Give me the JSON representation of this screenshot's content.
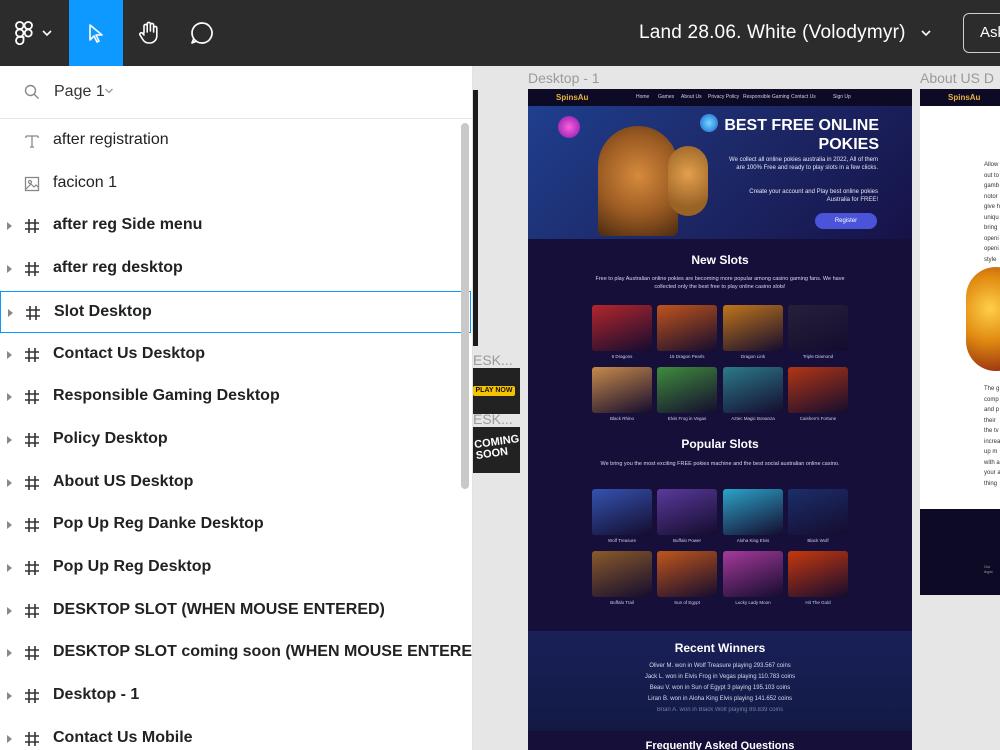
{
  "toolbar": {
    "file_title": "Land 28.06. White (Volodymyr)",
    "share_label": "Ask",
    "icons": [
      "figma-logo-icon",
      "chevron-down-icon",
      "move-tool-icon",
      "hand-tool-icon",
      "comment-icon"
    ]
  },
  "layers_panel": {
    "page_label": "Page 1",
    "layers": [
      {
        "name": "after registration",
        "type": "text",
        "expandable": false
      },
      {
        "name": "facicon 1",
        "type": "image",
        "expandable": false
      },
      {
        "name": "after reg Side menu",
        "type": "frame",
        "expandable": true
      },
      {
        "name": "after reg desktop",
        "type": "frame",
        "expandable": true
      },
      {
        "name": "Slot Desktop",
        "type": "frame",
        "expandable": true,
        "selected": true
      },
      {
        "name": "Contact Us Desktop",
        "type": "frame",
        "expandable": true
      },
      {
        "name": "Responsible Gaming Desktop",
        "type": "frame",
        "expandable": true
      },
      {
        "name": "Policy Desktop",
        "type": "frame",
        "expandable": true
      },
      {
        "name": "About US Desktop",
        "type": "frame",
        "expandable": true
      },
      {
        "name": "Pop Up Reg Danke Desktop",
        "type": "frame",
        "expandable": true
      },
      {
        "name": "Pop Up Reg Desktop",
        "type": "frame",
        "expandable": true
      },
      {
        "name": "DESKTOP SLOT (WHEN MOUSE ENTERED)",
        "type": "frame",
        "expandable": true
      },
      {
        "name": "DESKTOP SLOT coming soon (WHEN MOUSE ENTERED)",
        "type": "frame",
        "expandable": true
      },
      {
        "name": "Desktop - 1",
        "type": "frame",
        "expandable": true
      },
      {
        "name": "Contact Us Mobile",
        "type": "frame",
        "expandable": true
      }
    ]
  },
  "canvas": {
    "frame_desktop1_label": "Desktop - 1",
    "frame_about_label": "About US D",
    "partial_label_1": "ESK...",
    "partial_label_2": "ESK...",
    "play_now": "PLAY NOW",
    "coming_soon": "COMING SOON"
  },
  "site": {
    "logo": "SpinsAu",
    "nav": [
      "Home",
      "Games",
      "About Us",
      "Privacy Policy",
      "Responsible Gaming",
      "Contact Us",
      "Sign Up"
    ],
    "hero_title": "BEST FREE ONLINE POKIES",
    "hero_text": "We collect all online pokies australia in 2022, All of them are 100% Free and ready to play slots in a few clicks.",
    "hero_text2": "Create your account and Play best online pokies Australia for FREE!",
    "register": "Register",
    "new_slots_title": "New Slots",
    "new_slots_text": "Free to play Australian online pokies are becoming more popular among casino gaming fans. We have collected only the best free to play online casino slots!",
    "new_slots": [
      {
        "name": "5 Dragons",
        "color": "#b3262d"
      },
      {
        "name": "15 Dragon Pearls",
        "color": "#c0541c"
      },
      {
        "name": "Dragon Link",
        "color": "#c0751a"
      },
      {
        "name": "Triple Diamond",
        "color": "#27203a"
      },
      {
        "name": "Black Rhino",
        "color": "#c78a4a"
      },
      {
        "name": "Elvis Frog in Vegas",
        "color": "#3f8c3c"
      },
      {
        "name": "Aztec Magic Bonanza",
        "color": "#2c7a8a"
      },
      {
        "name": "Caishen's Fortune",
        "color": "#b23614"
      }
    ],
    "popular_slots_title": "Popular Slots",
    "popular_slots_text": "We bring you the most exciting FREE pokies machine and the best social australian online casino.",
    "popular_slots": [
      {
        "name": "Wolf Treasure",
        "color": "#3553b0"
      },
      {
        "name": "Buffalo Power",
        "color": "#5a3a9a"
      },
      {
        "name": "Aloha King Elvis",
        "color": "#2ca3c8"
      },
      {
        "name": "Black Wolf",
        "color": "#1c2e6a"
      },
      {
        "name": "Buffalo Trail",
        "color": "#8a5a2a"
      },
      {
        "name": "Sun of Egypt",
        "color": "#c0561a"
      },
      {
        "name": "Lucky Lady Moon",
        "color": "#a43a9a"
      },
      {
        "name": "Hit The Gold",
        "color": "#c8380e"
      }
    ],
    "recent_winners_title": "Recent Winners",
    "winners": [
      "Oliver M. won in Wolf Treasure playing 293.567 coins",
      "Jack L. won in Elvis Frog in Vegas playing 110.783 coins",
      "Beau V. won in Sun of Egypt 3 playing 195.103 coins",
      "Liran B. won in Aloha King Elvis playing 141.652 coins",
      "Brian A. won in Black Wolf playing 89.839 coins"
    ],
    "faq_title": "Frequently Asked Questions",
    "about_logo": "SpinsAu",
    "about_lines_top": [
      "Allow",
      "out to",
      "gamb",
      "notor",
      "give h",
      "uniqu",
      "bring",
      "openi",
      "openi",
      "style"
    ],
    "about_lines_bottom": [
      "The g",
      "comp",
      "and p",
      "their",
      "the tv",
      "increa",
      "up m",
      "with a",
      "your a",
      "thing"
    ],
    "about_footer_text": "Our legal"
  }
}
